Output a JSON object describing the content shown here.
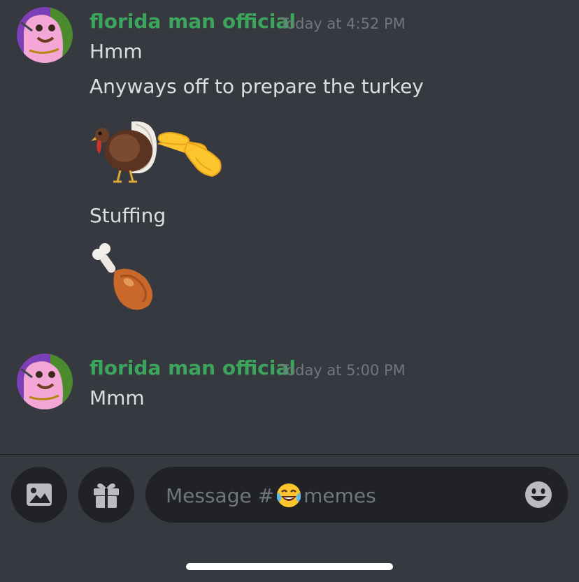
{
  "colors": {
    "background": "#36393f",
    "username": "#3ba55c",
    "timestamp": "#72767d",
    "message_text": "#dcddde",
    "input_bg": "#202225",
    "icon": "#b9bbbe"
  },
  "messages": [
    {
      "author": "florida man official",
      "timestamp": "Today at 4:52 PM",
      "lines": [
        {
          "type": "text",
          "text": "Hmm"
        },
        {
          "type": "text",
          "text": "Anyways off to prepare the turkey"
        },
        {
          "type": "emoji",
          "emojis": [
            "turkey",
            "pinching-hand"
          ]
        },
        {
          "type": "text",
          "text": "Stuffing"
        },
        {
          "type": "emoji",
          "emojis": [
            "poultry-leg"
          ]
        }
      ]
    },
    {
      "author": "florida man official",
      "timestamp": "Today at 5:00 PM",
      "lines": [
        {
          "type": "text",
          "text": "Mmm"
        }
      ]
    }
  ],
  "composer": {
    "placeholder_prefix": "Message #",
    "placeholder_channel": "memes",
    "channel_emoji": "joy-emoji",
    "buttons": [
      "image-icon",
      "gift-icon",
      "smiley-icon"
    ]
  }
}
